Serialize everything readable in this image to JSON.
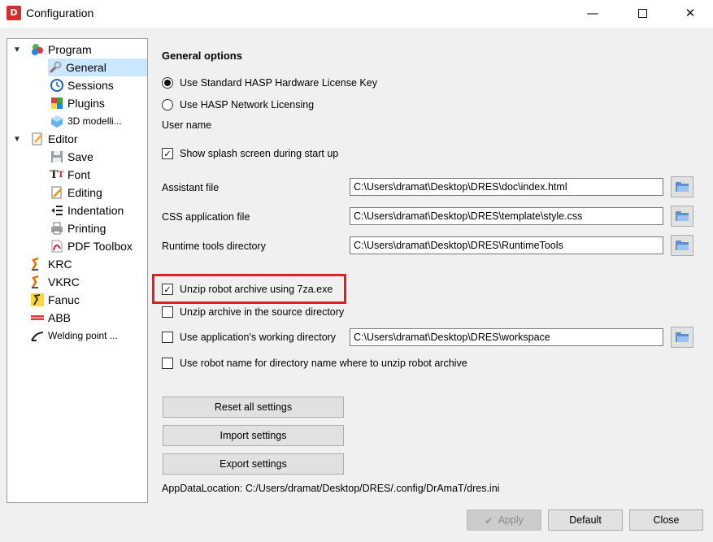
{
  "window": {
    "title": "Configuration",
    "icon_label": "D"
  },
  "tree": {
    "items": [
      {
        "label": "Program",
        "icon": "program-icon"
      },
      {
        "label": "General",
        "icon": "wrench-icon"
      },
      {
        "label": "Sessions",
        "icon": "clock-icon"
      },
      {
        "label": "Plugins",
        "icon": "plugin-icon"
      },
      {
        "label": "3D modelli...",
        "icon": "cube-icon"
      },
      {
        "label": "Editor",
        "icon": "editor-icon"
      },
      {
        "label": "Save",
        "icon": "save-icon"
      },
      {
        "label": "Font",
        "icon": "font-icon"
      },
      {
        "label": "Editing",
        "icon": "pencil-icon"
      },
      {
        "label": "Indentation",
        "icon": "indent-icon"
      },
      {
        "label": "Printing",
        "icon": "printer-icon"
      },
      {
        "label": "PDF Toolbox",
        "icon": "pdf-icon"
      },
      {
        "label": "KRC",
        "icon": "robot-arm-icon"
      },
      {
        "label": "VKRC",
        "icon": "robot-arm-icon"
      },
      {
        "label": "Fanuc",
        "icon": "fanuc-icon"
      },
      {
        "label": "ABB",
        "icon": "abb-logo-icon"
      },
      {
        "label": "Welding point ...",
        "icon": "welding-icon"
      }
    ]
  },
  "general": {
    "section_title": "General options",
    "license_standard": "Use Standard HASP Hardware License Key",
    "license_network": "Use HASP Network Licensing",
    "user_name_label": "User name",
    "splash_label": "Show splash screen during start up",
    "assistant_label": "Assistant file",
    "assistant_value": "C:\\Users\\dramat\\Desktop\\DRES\\doc\\index.html",
    "css_label": "CSS application file",
    "css_value": "C:\\Users\\dramat\\Desktop\\DRES\\template\\style.css",
    "runtime_label": "Runtime tools directory",
    "runtime_value": "C:\\Users\\dramat\\Desktop\\DRES\\RuntimeTools",
    "unzip_7za_label": "Unzip robot archive using 7za.exe",
    "unzip_source_label": "Unzip archive in the source directory",
    "working_dir_label": "Use application's working directory",
    "working_dir_value": "C:\\Users\\dramat\\Desktop\\DRES\\workspace",
    "robot_name_label": "Use robot name for directory name where to unzip robot archive",
    "reset_label": "Reset all settings",
    "import_label": "Import settings",
    "export_label": "Export settings",
    "app_data": "AppDataLocation: C:/Users/dramat/Desktop/DRES/.config/DrAmaT/dres.ini"
  },
  "footer": {
    "apply_label": "Apply",
    "default_label": "Default",
    "close_label": "Close"
  },
  "state": {
    "license_standard_selected": true,
    "splash_checked": true,
    "unzip_7za_checked": true,
    "unzip_source_checked": false,
    "working_dir_checked": false,
    "robot_name_checked": false
  },
  "colors": {
    "highlight": "#e02020",
    "selection": "#cce8ff"
  }
}
